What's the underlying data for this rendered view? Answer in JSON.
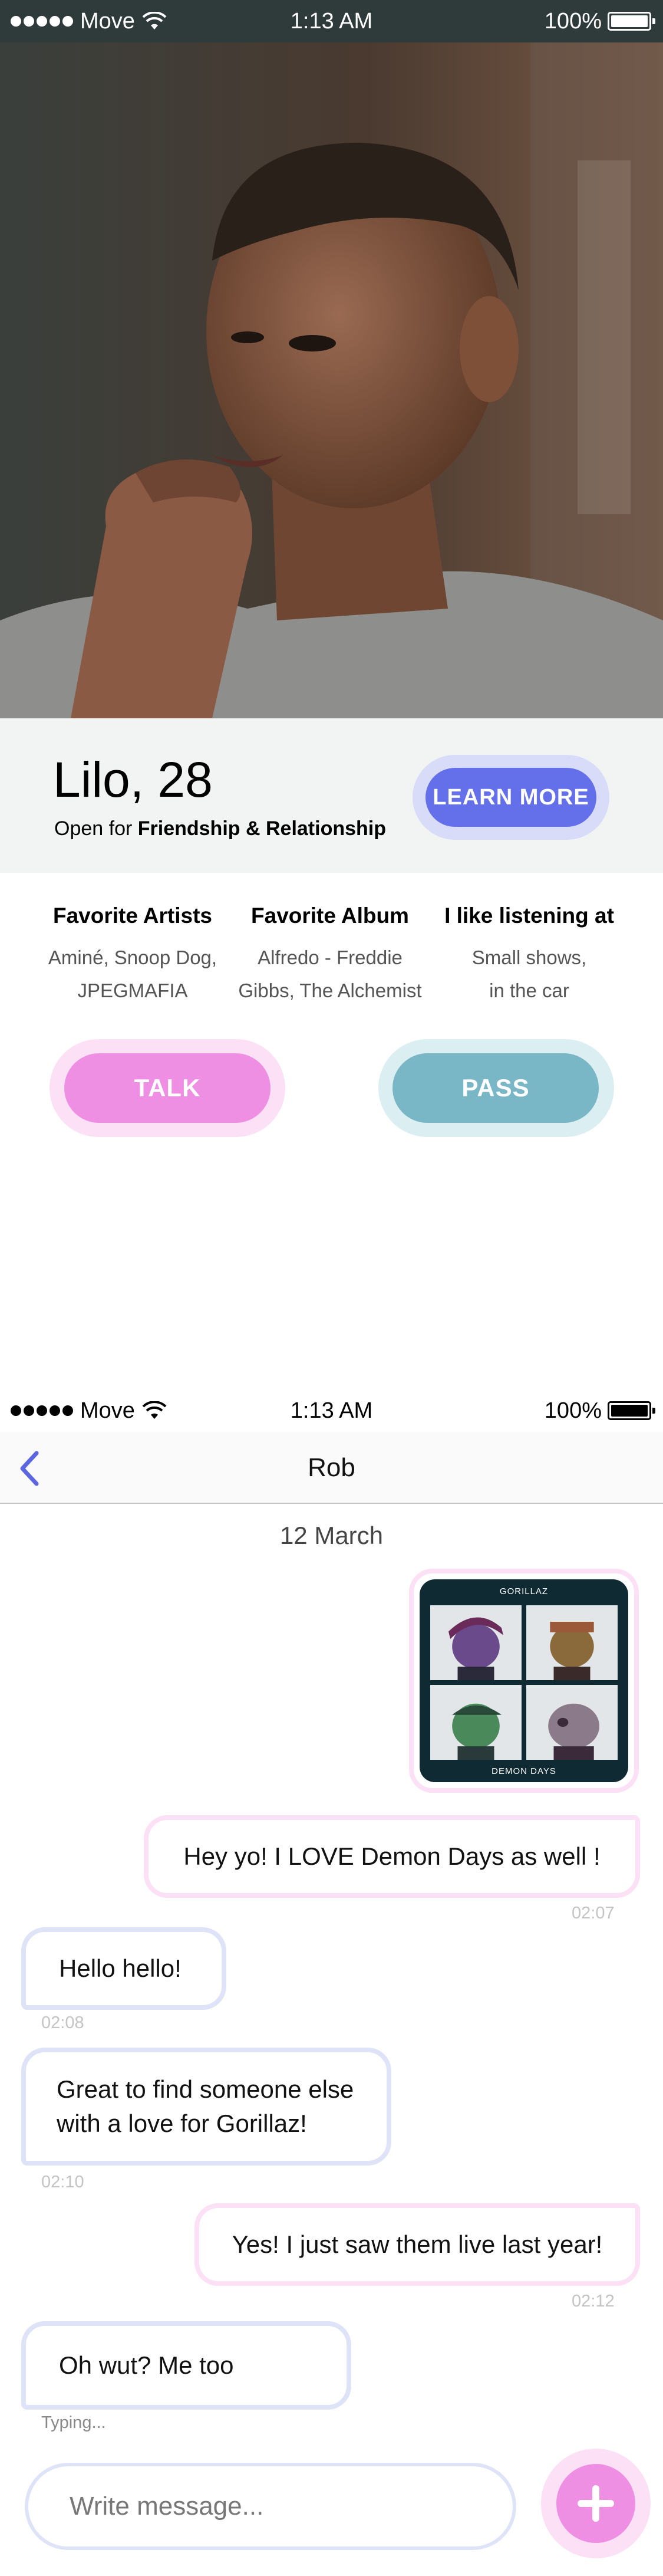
{
  "profile_screen": {
    "status_bar": {
      "carrier": "Move",
      "time": "1:13 AM",
      "battery": "100%"
    },
    "profile": {
      "name_age": "Lilo, 28",
      "open_for_prefix": "Open for ",
      "open_for_value": "Friendship & Relationship",
      "learn_more_label": "LEARN MORE"
    },
    "facts": [
      {
        "title": "Favorite Artists",
        "line1": "Aminé, Snoop Dog,",
        "line2": "JPEGMAFIA"
      },
      {
        "title": "Favorite Album",
        "line1": "Alfredo - Freddie",
        "line2": "Gibbs, The Alchemist"
      },
      {
        "title": "I like listening at",
        "line1": "Small shows,",
        "line2": "in the car"
      }
    ],
    "actions": {
      "talk_label": "TALK",
      "pass_label": "PASS"
    },
    "colors": {
      "accent_blue": "#6470ea",
      "talk_pink": "#ef8fe3",
      "pass_teal": "#79b6c6"
    }
  },
  "chat_screen": {
    "status_bar": {
      "carrier": "Move",
      "time": "1:13 AM",
      "battery": "100%"
    },
    "header": {
      "title": "Rob"
    },
    "date_separator": "12 March",
    "album_art": {
      "top_text": "GORILLAZ",
      "bottom_text": "DEMON DAYS"
    },
    "messages": [
      {
        "from": "me",
        "text": "Hey yo!  I LOVE Demon Days as well !",
        "time": "02:07"
      },
      {
        "from": "them",
        "text": "Hello hello!",
        "time": "02:08"
      },
      {
        "from": "them",
        "line1": "Great to find someone else",
        "line2": "with a love for Gorillaz!",
        "time": "02:10"
      },
      {
        "from": "me",
        "text": "Yes! I just saw them live last year!",
        "time": "02:12"
      },
      {
        "from": "them",
        "text": "Oh wut? Me too",
        "time": "Typing..."
      }
    ],
    "composer": {
      "placeholder": "Write message..."
    }
  }
}
